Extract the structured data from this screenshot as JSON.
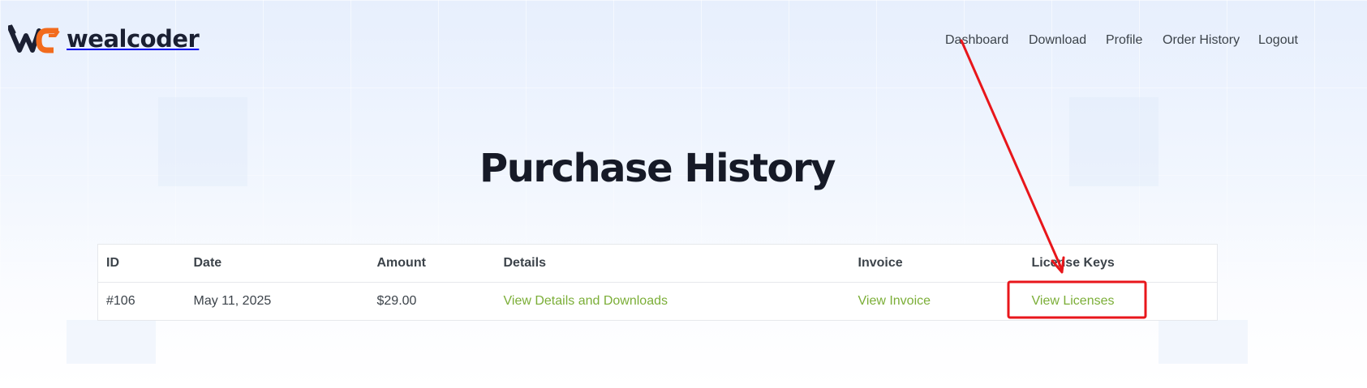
{
  "brand": {
    "name": "wealcoder",
    "colors": {
      "accent": "#f26b1d",
      "dark": "#1b2033"
    }
  },
  "nav": {
    "items": [
      {
        "label": "Dashboard"
      },
      {
        "label": "Download"
      },
      {
        "label": "Profile"
      },
      {
        "label": "Order History"
      },
      {
        "label": "Logout"
      }
    ]
  },
  "page": {
    "title": "Purchase History"
  },
  "table": {
    "columns": [
      "ID",
      "Date",
      "Amount",
      "Details",
      "Invoice",
      "License Keys"
    ],
    "rows": [
      {
        "id": "#106",
        "date": "May 11, 2025",
        "amount": "$29.00",
        "details": "View Details and Downloads",
        "invoice": "View Invoice",
        "license": "View Licenses"
      }
    ],
    "link_color": "#7bae37"
  },
  "annotation": {
    "color": "#e8161b",
    "icons": [
      "arrow-annotation",
      "highlight-box"
    ]
  }
}
